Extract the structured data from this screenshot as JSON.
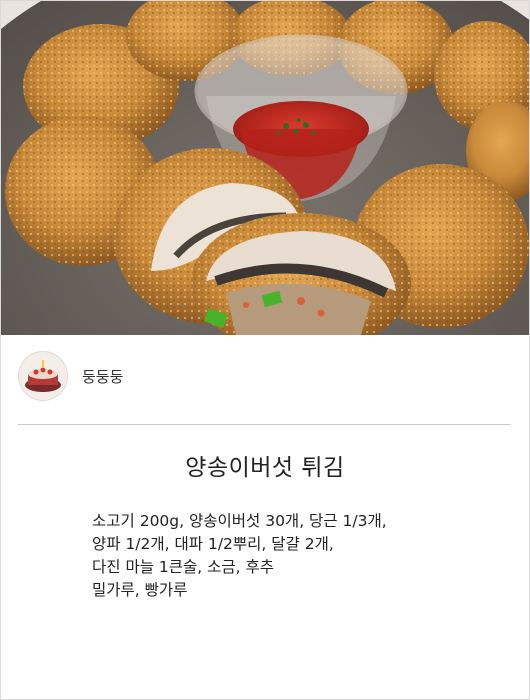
{
  "hero": {
    "image_subject": "fried-stuffed-mushroom-photo"
  },
  "author": {
    "name": "둥둥둥"
  },
  "recipe": {
    "title": "양송이버섯 튀김",
    "ingredient_lines": [
      "소고기 200g, 양송이버섯 30개, 당근 1/3개,",
      "양파 1/2개, 대파 1/2뿌리, 달걀 2개,",
      "다진 마늘 1큰술, 소금, 후추",
      "밀가루, 빵가루"
    ]
  },
  "colors": {
    "fried_crust": "#c98a3a",
    "plate": "#5f5853",
    "ketchup": "#c0281f",
    "divider": "#c9c9c9"
  }
}
